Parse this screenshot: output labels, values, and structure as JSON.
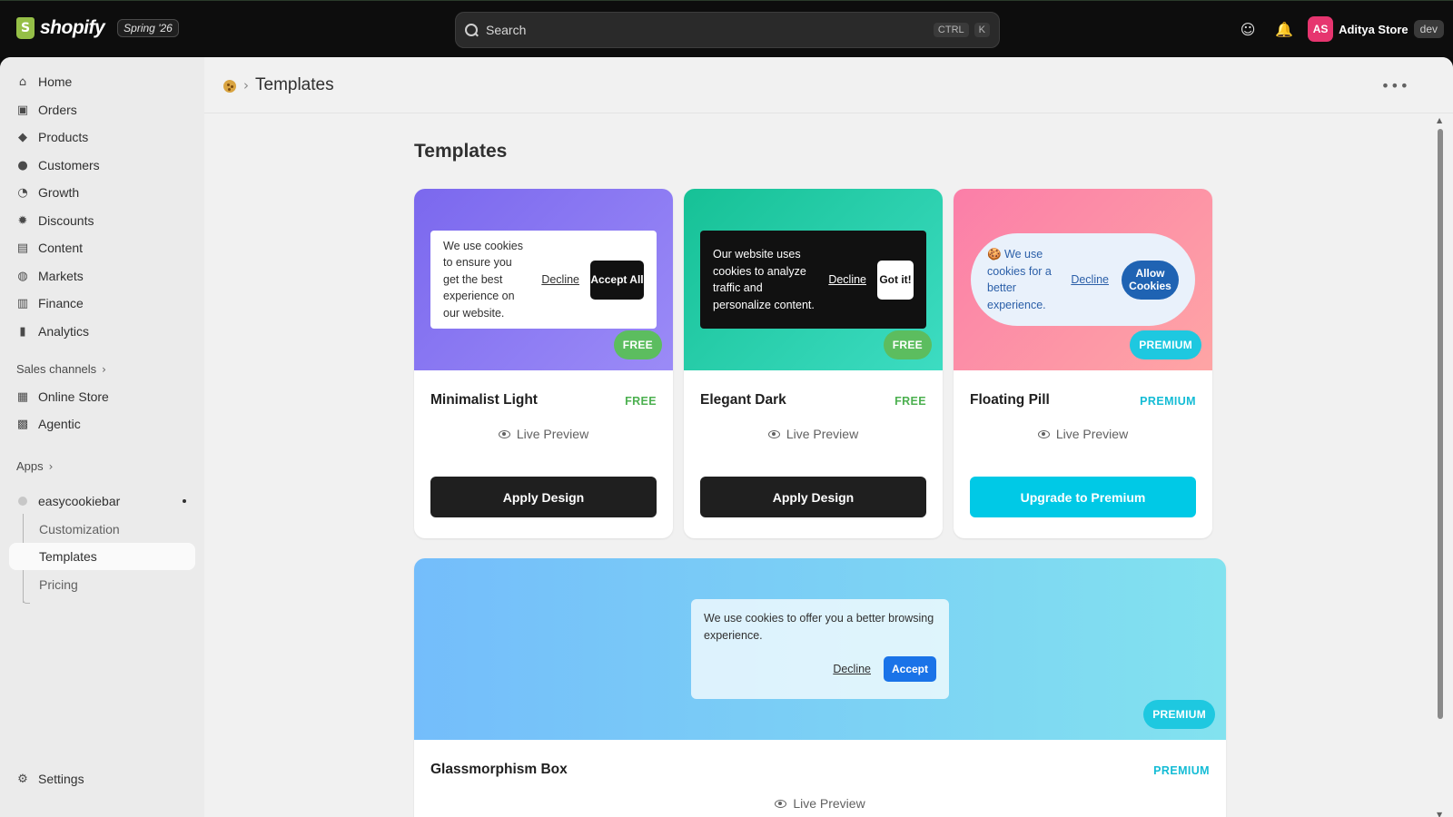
{
  "topbar": {
    "brand": "shopify",
    "edition": "Spring '26",
    "search_placeholder": "Search",
    "shortcut_ctrl": "CTRL",
    "shortcut_key": "K",
    "avatar_initials": "AS",
    "store_name": "Aditya Store",
    "env_badge": "dev"
  },
  "sidebar": {
    "items": [
      {
        "label": "Home",
        "icon": "home-icon"
      },
      {
        "label": "Orders",
        "icon": "orders-icon"
      },
      {
        "label": "Products",
        "icon": "tag-icon"
      },
      {
        "label": "Customers",
        "icon": "person-icon"
      },
      {
        "label": "Growth",
        "icon": "gauge-icon"
      },
      {
        "label": "Discounts",
        "icon": "discount-icon"
      },
      {
        "label": "Content",
        "icon": "content-icon"
      },
      {
        "label": "Markets",
        "icon": "globe-icon"
      },
      {
        "label": "Finance",
        "icon": "bank-icon"
      },
      {
        "label": "Analytics",
        "icon": "bar-chart-icon"
      }
    ],
    "sales_channels_label": "Sales channels",
    "channels": [
      {
        "label": "Online Store",
        "icon": "store-icon"
      },
      {
        "label": "Agentic",
        "icon": "agent-icon"
      }
    ],
    "apps_label": "Apps",
    "app_name": "easycookiebar",
    "app_subitems": [
      "Customization",
      "Templates",
      "Pricing"
    ],
    "settings_label": "Settings"
  },
  "page": {
    "breadcrumb_title": "Templates",
    "heading": "Templates",
    "live_preview": "Live Preview"
  },
  "templates": [
    {
      "name": "Minimalist Light",
      "tier": "FREE",
      "banner_text": "We use cookies to ensure you get the best experience on our website.",
      "decline": "Decline",
      "accept": "Accept All",
      "action": "Apply Design"
    },
    {
      "name": "Elegant Dark",
      "tier": "FREE",
      "banner_text": "Our website uses cookies to analyze traffic and personalize content.",
      "decline": "Decline",
      "accept": "Got it!",
      "action": "Apply Design"
    },
    {
      "name": "Floating Pill",
      "tier": "PREMIUM",
      "banner_text": "🍪 We use cookies for a better experience.",
      "decline": "Decline",
      "accept": "Allow Cookies",
      "action": "Upgrade to Premium"
    },
    {
      "name": "Glassmorphism Box",
      "tier": "PREMIUM",
      "banner_text": "We use cookies to offer you a better browsing experience.",
      "decline": "Decline",
      "accept": "Accept"
    }
  ],
  "colors": {
    "free": "#4cb050",
    "premium": "#14bcd5",
    "brand": "#95bf47"
  }
}
